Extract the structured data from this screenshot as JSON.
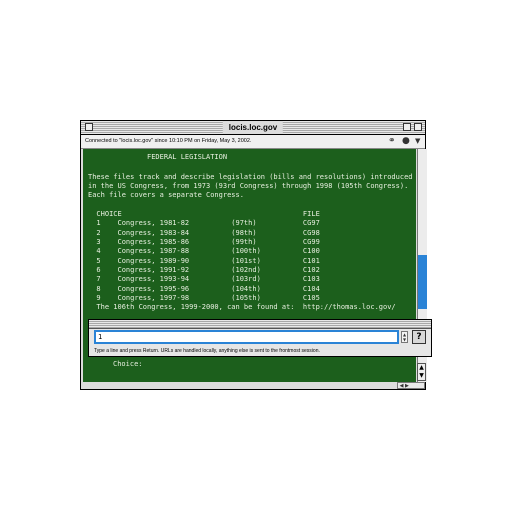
{
  "window": {
    "title": "locis.loc.gov",
    "status": "Connected to \"locis.loc.gov\" since 10:10 PM on Friday, May 3, 2002."
  },
  "terminal": {
    "lines": [
      "              FEDERAL LEGISLATION",
      "",
      "These files track and describe legislation (bills and resolutions) introduced",
      "in the US Congress, from 1973 (93rd Congress) through 1998 (105th Congress).",
      "Each file covers a separate Congress.",
      "",
      "  CHOICE                                           FILE",
      "  1    Congress, 1981-82          (97th)           CG97",
      "  2    Congress, 1983-84          (98th)           CG98",
      "  3    Congress, 1985-86          (99th)           CG99",
      "  4    Congress, 1987-88          (100th)          C100",
      "  5    Congress, 1989-90          (101st)          C101",
      "  6    Congress, 1991-92          (102nd)          C102",
      "  7    Congress, 1993-94          (103rd)          C103",
      "  8    Congress, 1995-96          (104th)          C104",
      "  9    Congress, 1997-98          (105th)          C105",
      "  The 106th Congress, 1999-2000, can be found at:  http://thomas.loc.gov/"
    ],
    "prompt": "Choice:"
  },
  "command": {
    "value": "1",
    "hint": "Type a line and press Return.  URLs are handled locally, anything else is sent to the frontmost session.",
    "help_label": "?"
  },
  "icons": {
    "lock": "lock-icon",
    "plug": "plug-icon"
  },
  "colors": {
    "terminal_bg": "#1c5f1c",
    "terminal_text": "#e8f0e0",
    "accent": "#2a83d6"
  }
}
